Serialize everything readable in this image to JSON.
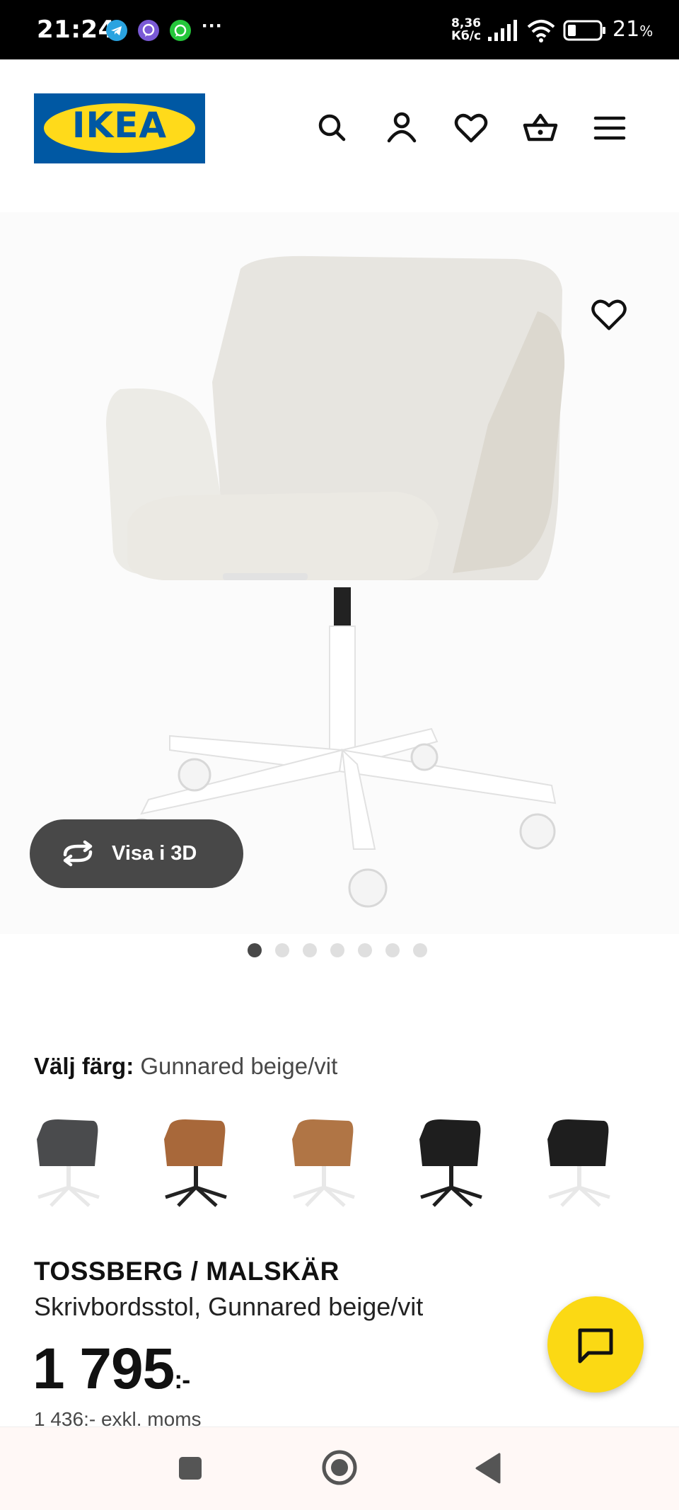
{
  "status_bar": {
    "time": "21:24",
    "net_speed_value": "8,36",
    "net_speed_unit": "Кб/с",
    "battery": "21",
    "battery_unit": "%",
    "overflow": "···"
  },
  "header": {
    "logo_text": "IKEA",
    "icons": [
      "search-icon",
      "account-icon",
      "favorites-icon",
      "shopping-cart-icon",
      "menu-icon"
    ]
  },
  "gallery": {
    "view_3d_label": "Visa i 3D",
    "image_count": 7,
    "active_index": 0
  },
  "color": {
    "label": "Välj färg:",
    "value": "Gunnared beige/vit",
    "options": [
      {
        "name": "dark-grey-white",
        "seat": "#4a4b4d",
        "base": "#f2f2f2"
      },
      {
        "name": "brown-black",
        "seat": "#a8683a",
        "base": "#222222"
      },
      {
        "name": "brown-white",
        "seat": "#b07545",
        "base": "#f2f2f2"
      },
      {
        "name": "black-black",
        "seat": "#1e1e1e",
        "base": "#1e1e1e"
      },
      {
        "name": "black-white",
        "seat": "#1e1e1e",
        "base": "#f2f2f2"
      }
    ]
  },
  "product": {
    "name": "TOSSBERG / MALSKÄR",
    "description": "Skrivbordsstol, Gunnared beige/vit",
    "price": "1 795",
    "price_suffix": ":-",
    "price_excl_vat": "1 436:- exkl. moms"
  },
  "colors": {
    "ikea_blue": "#0058a3",
    "ikea_yellow": "#ffda1a",
    "chat_yellow": "#fbd914",
    "button_dark": "#484848"
  }
}
